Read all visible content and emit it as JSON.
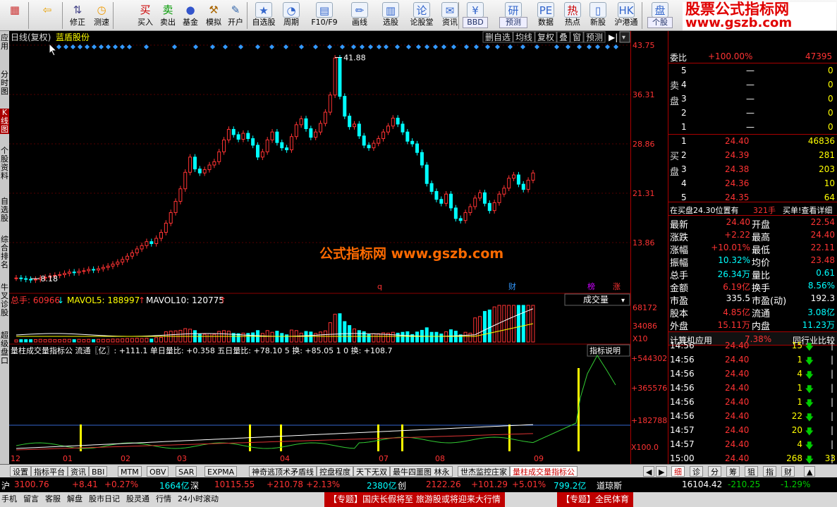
{
  "toolbar": {
    "buttons": [
      {
        "label": "",
        "icon": "grid-icon"
      },
      {
        "label": "",
        "icon": "back-arrow-icon"
      },
      {
        "label": "修正",
        "icon": "up-down-icon"
      },
      {
        "label": "测速",
        "icon": "clock-icon"
      },
      {
        "label": "买入",
        "icon": "buy-icon",
        "glyph": "买"
      },
      {
        "label": "卖出",
        "icon": "sell-icon",
        "glyph": "卖"
      },
      {
        "label": "基金",
        "icon": "fund-icon"
      },
      {
        "label": "模拟",
        "icon": "hammer-icon"
      },
      {
        "label": "开户",
        "icon": "account-icon"
      },
      {
        "label": "自选股",
        "icon": "star-folder-icon"
      },
      {
        "label": "周期",
        "icon": "period-icon"
      },
      {
        "label": "F10/F9",
        "icon": "f10-icon"
      },
      {
        "label": "画线",
        "icon": "pen-icon"
      },
      {
        "label": "选股",
        "icon": "chart-select-icon"
      },
      {
        "label": "论股堂",
        "icon": "forum-icon"
      },
      {
        "label": "资讯",
        "icon": "news-icon"
      },
      {
        "label": "资金",
        "icon": "money-icon"
      },
      {
        "label": "BBD",
        "icon": "bbd-icon"
      },
      {
        "label": "研报",
        "icon": "report-icon"
      },
      {
        "label": "预测",
        "icon": "forecast-icon"
      },
      {
        "label": "数据",
        "icon": "data-icon"
      },
      {
        "label": "热点",
        "icon": "hot-icon"
      },
      {
        "label": "新股",
        "icon": "new-stock-icon"
      },
      {
        "label": "沪港通",
        "icon": "hk-connect-icon"
      },
      {
        "label": "大盘",
        "icon": "market-icon"
      },
      {
        "label": "个股",
        "icon": "stock-icon"
      }
    ]
  },
  "brand": {
    "line1": "股票公式指标网",
    "line2": "www.gszb.com"
  },
  "left_tabs": [
    "应用",
    "分时图",
    "K线图",
    "个股资料",
    "自选股",
    "综合排名",
    "牛叉诊股",
    "超级盘口"
  ],
  "chart_header": {
    "title": "日线(复权)",
    "stock": "蓝盾股份",
    "buttons": [
      "删自选",
      "均线",
      "复权",
      "叠",
      "窗",
      "预测"
    ]
  },
  "watermark": "公式指标网  www.gszb.com",
  "price_axis": [
    "43.75",
    "36.31",
    "28.86",
    "21.31",
    "13.86"
  ],
  "annotations": {
    "high": "41.88",
    "low": "8.18",
    "markers": [
      "q",
      "财",
      "榜",
      "涨"
    ]
  },
  "volume": {
    "label": "总手: 60966",
    "mavol5": "MAVOL5: 188997",
    "mavol10": "MAVOL10: 120775",
    "dropdown": "成交量",
    "axis": [
      "68172",
      "34086",
      "X10"
    ]
  },
  "indicator": {
    "text": "量柱成交量指标公 流通〖亿〗: +111.1  单日量比: +0.358  五日量比: +78.10  5 换: +85.05  1 0 换: +108.7",
    "button": "指标说明",
    "axis": [
      "+544302",
      "+365576",
      "+182788",
      "X100.0"
    ]
  },
  "x_labels": [
    "12",
    "01",
    "02",
    "03",
    "04",
    "07",
    "08",
    "09"
  ],
  "right_panel": {
    "weibi": {
      "label": "委比",
      "value": "+100.00%",
      "diff": "47395"
    },
    "sell": [
      {
        "lvl": "5",
        "p": "—",
        "v": "0"
      },
      {
        "lvl": "4",
        "p": "—",
        "v": "0"
      },
      {
        "lvl": "3",
        "p": "—",
        "v": "0"
      },
      {
        "lvl": "2",
        "p": "—",
        "v": "0"
      },
      {
        "lvl": "1",
        "p": "—",
        "v": "0"
      }
    ],
    "sell_label": "卖盘",
    "buy": [
      {
        "lvl": "1",
        "p": "24.40",
        "v": "46836"
      },
      {
        "lvl": "2",
        "p": "24.39",
        "v": "281"
      },
      {
        "lvl": "3",
        "p": "24.38",
        "v": "203"
      },
      {
        "lvl": "4",
        "p": "24.36",
        "v": "10"
      },
      {
        "lvl": "5",
        "p": "24.35",
        "v": "64"
      }
    ],
    "buy_label": "买盘",
    "notice": {
      "text": "在买盘24.30位置有",
      "qty": "321手",
      "link": "买单!查看详细"
    },
    "stats": [
      [
        "最新",
        "24.40",
        "开盘",
        "22.54"
      ],
      [
        "涨跌",
        "+2.22",
        "最高",
        "24.40"
      ],
      [
        "涨幅",
        "+10.01%",
        "最低",
        "22.11"
      ],
      [
        "振幅",
        "10.32%",
        "均价",
        "23.48"
      ],
      [
        "总手",
        "26.34万",
        "量比",
        "0.61"
      ],
      [
        "金额",
        "6.19亿",
        "换手",
        "8.56%"
      ],
      [
        "市盈",
        "335.5",
        "市盈(动)",
        "192.3"
      ],
      [
        "股本",
        "4.85亿",
        "流通",
        "3.08亿"
      ],
      [
        "外盘",
        "15.11万",
        "内盘",
        "11.23万"
      ]
    ],
    "calc": {
      "left": "计算机应用",
      "pct": "7.38%",
      "right": "同行业比较"
    },
    "ticks": [
      [
        "14:56",
        "24.40",
        "15"
      ],
      [
        "14:56",
        "24.40",
        "1"
      ],
      [
        "14:56",
        "24.40",
        "4"
      ],
      [
        "14:56",
        "24.40",
        "1"
      ],
      [
        "14:56",
        "24.40",
        "1"
      ],
      [
        "14:56",
        "24.40",
        "22"
      ],
      [
        "14:57",
        "24.40",
        "20"
      ],
      [
        "14:57",
        "24.40",
        "4"
      ],
      [
        "15:00",
        "24.40",
        "268"
      ]
    ],
    "tick_extra": "33"
  },
  "bottom_tabs": [
    "设置",
    "指标平台",
    "资讯",
    "BBI",
    "MTM",
    "OBV",
    "SAR",
    "EXPMA",
    "神奇逃顶术矛盾线",
    "控盘程度",
    "天下无双",
    "最牛四噩图 林永",
    "世杰监控庄家",
    "量柱成交量指标公"
  ],
  "right_tabs": [
    "细",
    "诊",
    "分",
    "筹",
    "狙",
    "指",
    "财"
  ],
  "ticker": [
    {
      "t": "沪",
      "c": "white"
    },
    {
      "t": "3100.76",
      "c": "red"
    },
    {
      "t": "+8.41",
      "c": "red"
    },
    {
      "t": "+0.27%",
      "c": "red"
    },
    {
      "t": "1664亿",
      "c": "cyan"
    },
    {
      "t": "深",
      "c": "white"
    },
    {
      "t": "10115.55",
      "c": "red"
    },
    {
      "t": "+210.78",
      "c": "red"
    },
    {
      "t": "+2.13%",
      "c": "red"
    },
    {
      "t": "2380亿",
      "c": "cyan"
    },
    {
      "t": "创",
      "c": "white"
    },
    {
      "t": "2122.26",
      "c": "red"
    },
    {
      "t": "+101.29",
      "c": "red"
    },
    {
      "t": "+5.01%",
      "c": "red"
    },
    {
      "t": "799.2亿",
      "c": "cyan"
    },
    {
      "t": "道琼斯",
      "c": "white"
    },
    {
      "t": "16104.42",
      "c": "white"
    },
    {
      "t": "-210.25",
      "c": "green"
    },
    {
      "t": "-1.29%",
      "c": "green"
    }
  ],
  "bottom_bar": [
    "手机",
    "留言",
    "客服",
    "解盘",
    "股市日记",
    "股灵通",
    "行情",
    "24小时滚动"
  ],
  "news": [
    "【专题】国庆长假将至 旅游股或将迎来大行情",
    "【专题】全民体育"
  ],
  "colors": {
    "up": "#ff3333",
    "down": "#00ffff",
    "grid": "#8b0000"
  }
}
